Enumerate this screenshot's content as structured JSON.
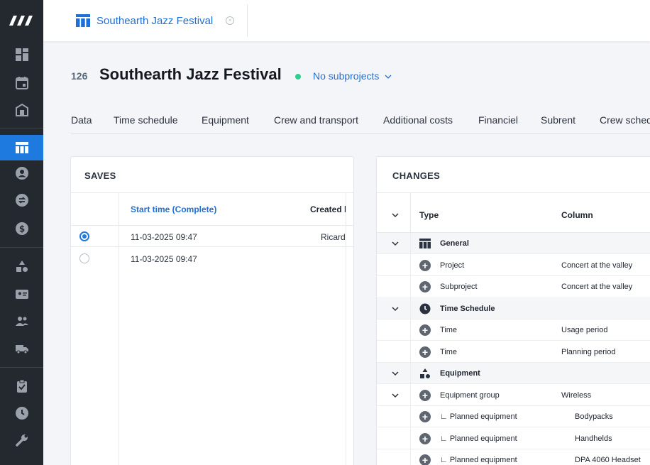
{
  "tab": {
    "label": "Southearth Jazz Festival",
    "close_symbol": "×"
  },
  "header": {
    "number": "126",
    "title": "Southearth Jazz Festival",
    "status_color": "#2fcf8f",
    "subprojects_label": "No subprojects"
  },
  "nav_tabs": [
    "Data",
    "Time schedule",
    "Equipment",
    "Crew and transport",
    "Additional costs",
    "Financiel",
    "Subrent",
    "Crew schedule"
  ],
  "saves": {
    "title": "SAVES",
    "col_start": "Start time (Complete)",
    "col_created": "Created by",
    "rows": [
      {
        "start": "11-03-2025 09:47",
        "created": "Ricardo",
        "selected": true
      },
      {
        "start": "11-03-2025 09:47",
        "created": "",
        "selected": false
      }
    ]
  },
  "changes": {
    "title": "CHANGES",
    "col_type": "Type",
    "col_column": "Column",
    "rows": [
      {
        "type": "General",
        "column": "",
        "group": true,
        "icon": "table-icon",
        "chevron": true
      },
      {
        "type": "Project",
        "column": "Concert at the valley",
        "group": false,
        "icon": "plus-circle-icon",
        "chevron": false
      },
      {
        "type": "Subproject",
        "column": "Concert at the valley",
        "group": false,
        "icon": "plus-circle-icon",
        "chevron": false
      },
      {
        "type": "Time Schedule",
        "column": "",
        "group": true,
        "icon": "clock-icon",
        "chevron": true
      },
      {
        "type": "Time",
        "column": "Usage period",
        "group": false,
        "icon": "plus-circle-icon",
        "chevron": false
      },
      {
        "type": "Time",
        "column": "Planning period",
        "group": false,
        "icon": "plus-circle-icon",
        "chevron": false
      },
      {
        "type": "Equipment",
        "column": "",
        "group": true,
        "icon": "shapes-icon",
        "chevron": true
      },
      {
        "type": "Equipment group",
        "column": "Wireless",
        "group": false,
        "icon": "plus-circle-icon",
        "chevron": true
      },
      {
        "type": "∟ Planned equipment",
        "column": "Bodypacks",
        "group": false,
        "icon": "plus-circle-icon",
        "chevron": false,
        "indent": true
      },
      {
        "type": "∟ Planned equipment",
        "column": "Handhelds",
        "group": false,
        "icon": "plus-circle-icon",
        "chevron": false,
        "indent": true
      },
      {
        "type": "∟ Planned equipment",
        "column": "DPA 4060 Headset",
        "group": false,
        "icon": "plus-circle-icon",
        "chevron": false,
        "indent": true
      }
    ]
  },
  "colors": {
    "accent": "#1f7ae0",
    "sidebar": "#24292f"
  }
}
